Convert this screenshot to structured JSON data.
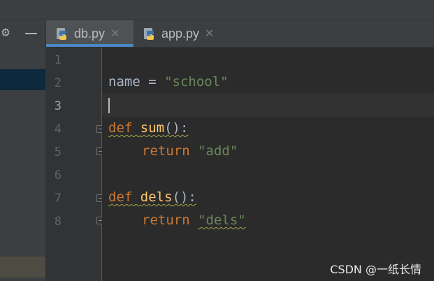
{
  "tabs": [
    {
      "label": "db.py",
      "active": true,
      "icon": "python-file-icon"
    },
    {
      "label": "app.py",
      "active": false,
      "icon": "python-file-icon"
    }
  ],
  "close_glyph": "✕",
  "line_numbers": [
    "1",
    "2",
    "3",
    "4",
    "5",
    "6",
    "7",
    "8"
  ],
  "current_line": "3",
  "code": {
    "line2": {
      "var": "name",
      "op": " = ",
      "str": "\"school\""
    },
    "line4": {
      "kw": "def",
      "fn": "sum",
      "rest": "():"
    },
    "line5": {
      "kw": "return",
      "str": "\"add\""
    },
    "line7": {
      "kw": "def",
      "fn": "dels",
      "rest": "():"
    },
    "line8": {
      "kw": "return",
      "str": "\"dels\""
    }
  },
  "watermark": "CSDN @一纸长情",
  "colors": {
    "keyword": "#cc7832",
    "function": "#ffc66d",
    "string": "#6a8759",
    "identifier": "#a9b7c6",
    "active_tab_underline": "#4a88c7",
    "editor_background": "#2b2b2b"
  }
}
